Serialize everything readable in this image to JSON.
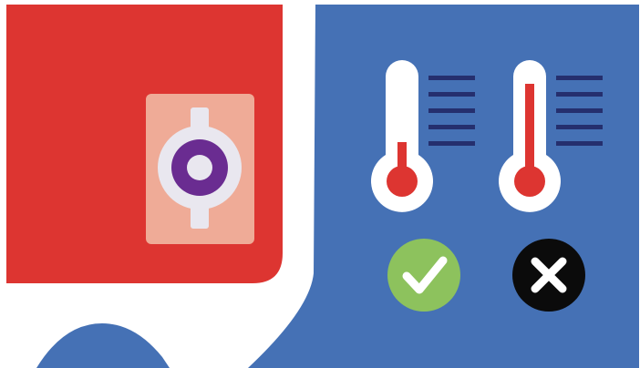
{
  "colors": {
    "background": "#ffffff",
    "red_panel": "#dd3531",
    "blue_panel": "#4571b5",
    "tile": "#efab97",
    "connector_ring": "#e9e7ef",
    "connector_core": "#6a2c91",
    "thermometer_body": "#ffffff",
    "mercury": "#dd3531",
    "scale_lines": "#252f6e",
    "check_circle": "#8dc25d",
    "cross_circle": "#0b0b0b",
    "mark": "#ffffff"
  },
  "icons": {
    "connector": "connector-icon",
    "thermometer_low": "thermometer-low-icon",
    "thermometer_high": "thermometer-high-icon",
    "check": "check-icon",
    "cross": "close-icon"
  },
  "thermometers": [
    {
      "name": "thermometer-low",
      "level": 0.3,
      "status": "ok"
    },
    {
      "name": "thermometer-high",
      "level": 0.95,
      "status": "fail"
    }
  ]
}
